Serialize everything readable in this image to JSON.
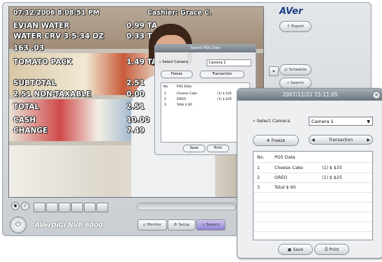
{
  "osd": {
    "datetime": "07/12/2006 8:08:51 PM",
    "cashier": "Cashier: Grace C.",
    "lines": [
      {
        "left": "EVIAN WATER",
        "right": "0.99 TA"
      },
      {
        "left": "WATER CRV 3.5-34 OZ",
        "right": "0.33 T"
      },
      {
        "left": "163 .03",
        "right": ""
      },
      {
        "left": "TOMATO PACK",
        "right": "1.49 TA"
      },
      {
        "left": "SUBTOTAL",
        "right": "2.51"
      },
      {
        "left": "2.51 NON-TAXABLE",
        "right": "0.00"
      },
      {
        "left": "TOTAL",
        "right": "2.51"
      },
      {
        "left": "CASH",
        "right": "10.00"
      },
      {
        "left": "CHANGE",
        "right": "7.49"
      }
    ]
  },
  "main": {
    "logo": "AVer",
    "brand": "AVerDiGi NVR 6000",
    "side_buttons": [
      "Export",
      "Schedule",
      "Search"
    ],
    "tabs": [
      "Monitor",
      "Setup",
      "Search"
    ]
  },
  "back_dialog": {
    "title": "Search POS Data",
    "select_camera_label": "Select Camera",
    "camera_value": "Camera 1",
    "freeze_label": "Freeze",
    "transaction_label": "Transaction",
    "header_no": "No.",
    "header_data": "POS Data",
    "rows": [
      {
        "no": "1",
        "item": "Cheese Cake",
        "qty": "(1) $ $35"
      },
      {
        "no": "2",
        "item": "OREO",
        "qty": "(1) $ $25"
      },
      {
        "no": "3",
        "item": "Total $ 60",
        "qty": ""
      }
    ],
    "save_label": "Save",
    "print_label": "Print"
  },
  "pos_dialog": {
    "title": "2007/11/22 15:11:05",
    "select_camera_label": "Select Camera",
    "camera_value": "Camera 1",
    "freeze_label": "Freeze",
    "transaction_label": "Transaction",
    "header_no": "No.",
    "header_data": "POS Data",
    "rows": [
      {
        "no": "1",
        "item": "Cheese Cake",
        "qty": "(1) $ $35"
      },
      {
        "no": "2",
        "item": "OREO",
        "qty": "(1) $ $25"
      },
      {
        "no": "3",
        "item": "Total $ 60",
        "qty": ""
      }
    ],
    "save_label": "Save",
    "print_label": "Print"
  }
}
